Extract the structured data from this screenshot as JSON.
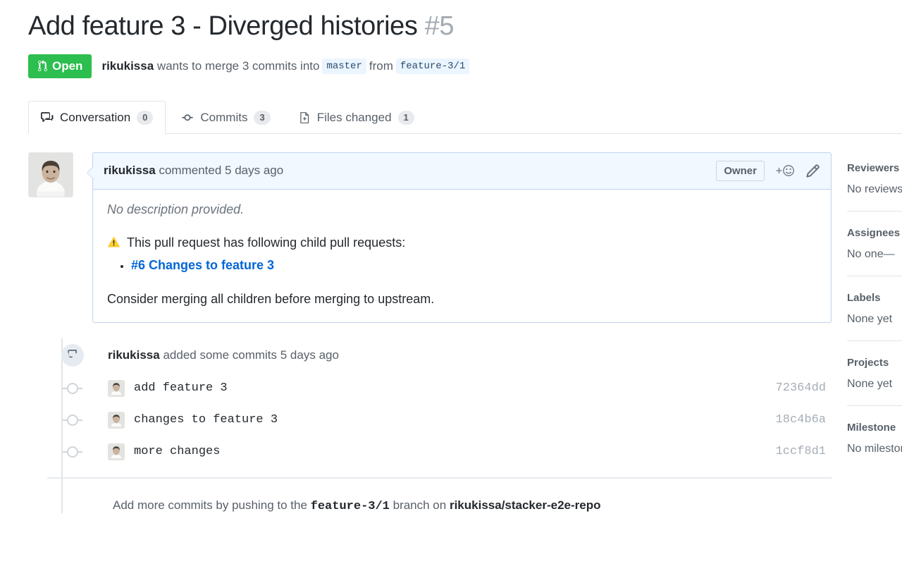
{
  "pr": {
    "title": "Add feature 3 - Diverged histories",
    "number": "#5",
    "state_label": "Open",
    "author": "rikukissa",
    "merge_text_1": "wants to merge 3 commits into",
    "base_branch": "master",
    "merge_text_2": "from",
    "head_branch": "feature-3/1"
  },
  "tabs": [
    {
      "label": "Conversation",
      "count": "0",
      "icon": "comment-discussion-icon",
      "active": true
    },
    {
      "label": "Commits",
      "count": "3",
      "icon": "git-commit-icon",
      "active": false
    },
    {
      "label": "Files changed",
      "count": "1",
      "icon": "diff-icon",
      "active": false
    }
  ],
  "comment": {
    "author": "rikukissa",
    "action_text": "commented 5 days ago",
    "owner_badge": "Owner",
    "add_reaction_icon": "add-reaction-icon",
    "edit_icon": "pencil-icon",
    "no_description": "No description provided.",
    "warning_emoji": "⚠️",
    "warning_text": "This pull request has following child pull requests:",
    "children": [
      {
        "label": "#6 Changes to feature 3"
      }
    ],
    "footer_text": "Consider merging all children before merging to upstream."
  },
  "timeline": {
    "push_event": {
      "author": "rikukissa",
      "text": "added some commits 5 days ago",
      "icon": "repo-push-icon"
    },
    "commits": [
      {
        "message": "add feature 3",
        "sha": "72364dd"
      },
      {
        "message": "changes to feature 3",
        "sha": "18c4b6a"
      },
      {
        "message": "more changes",
        "sha": "1ccf8d1"
      }
    ],
    "push_note_prefix": "Add more commits by pushing to the",
    "push_note_branch": "feature-3/1",
    "push_note_middle": "branch on",
    "push_note_repo": "rikukissa/stacker-e2e-repo"
  },
  "sidebar": [
    {
      "title": "Reviewers",
      "value": "No reviews"
    },
    {
      "title": "Assignees",
      "value": "No one—"
    },
    {
      "title": "Labels",
      "value": "None yet"
    },
    {
      "title": "Projects",
      "value": "None yet"
    },
    {
      "title": "Milestone",
      "value": "No milestone"
    }
  ],
  "colors": {
    "open_green": "#2cbe4e",
    "link_blue": "#0366d6",
    "comment_header_bg": "#f1f8ff",
    "comment_border": "#c0d3eb",
    "muted": "#586069",
    "sha_gray": "#a5aeb6"
  }
}
